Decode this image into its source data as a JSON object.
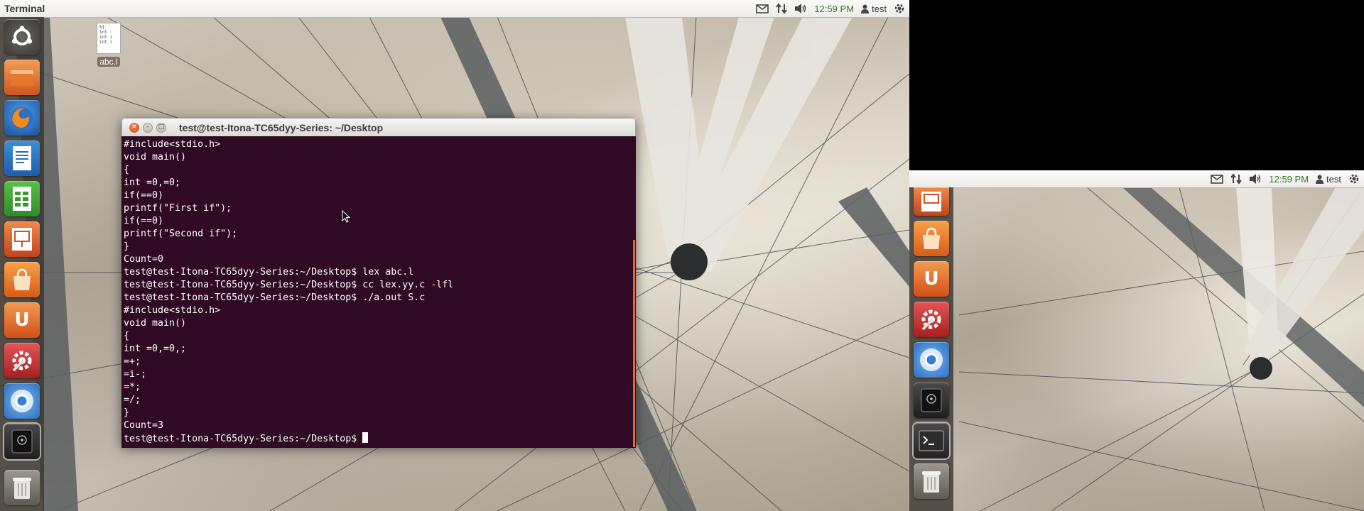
{
  "left_screen": {
    "panel": {
      "app_title": "Terminal",
      "clock": "12:59 PM",
      "user": "test",
      "icons": [
        "mail-icon",
        "network-icon",
        "volume-icon",
        "user-icon",
        "power-gear-icon"
      ]
    },
    "launcher": [
      "dash-icon",
      "files-icon",
      "firefox-icon",
      "writer-icon",
      "calc-icon",
      "impress-icon",
      "software-center-icon",
      "ubuntu-one-icon",
      "system-settings-icon",
      "chromium-icon",
      "vault-icon",
      "trash-icon"
    ],
    "desktop_file": {
      "label": "abc.l",
      "preview": [
        "%{",
        "int :",
        "int i",
        "int ("
      ]
    },
    "terminal": {
      "title": "test@test-Itona-TC65dyy-Series: ~/Desktop",
      "lines": [
        "#include<stdio.h>",
        "void main()",
        "{",
        "int =0,=0;",
        "if(==0)",
        "printf(\"First if\");",
        "if(==0)",
        "printf(\"Second if\");",
        "}",
        "Count=0",
        "test@test-Itona-TC65dyy-Series:~/Desktop$ lex abc.l",
        "test@test-Itona-TC65dyy-Series:~/Desktop$ cc lex.yy.c -lfl",
        "test@test-Itona-TC65dyy-Series:~/Desktop$ ./a.out S.c",
        "#include<stdio.h>",
        "void main()",
        "{",
        "int =0,=0,;",
        "=+;",
        "=i-;",
        "=*;",
        "=/;",
        "}",
        "Count=3"
      ],
      "prompt": "test@test-Itona-TC65dyy-Series:~/Desktop$ "
    }
  },
  "right_screen": {
    "panel": {
      "clock": "12:59 PM",
      "user": "test"
    },
    "launcher": [
      "impress-icon",
      "software-center-icon",
      "ubuntu-one-icon",
      "system-settings-icon",
      "chromium-icon",
      "vault-icon",
      "terminal-icon",
      "trash-icon"
    ]
  },
  "colors": {
    "terminal_bg": "#300a24",
    "clock_green": "#2f7e23",
    "accent_orange": "#e2683a"
  }
}
